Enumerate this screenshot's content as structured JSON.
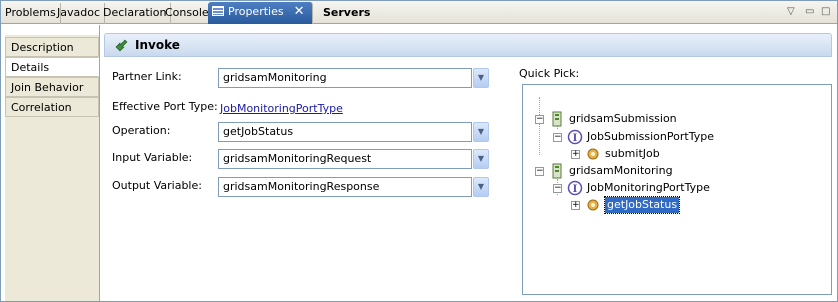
{
  "tabs": [
    {
      "label": "Problems"
    },
    {
      "label": "Javadoc"
    },
    {
      "label": "Declaration"
    },
    {
      "label": "Console"
    },
    {
      "label": "Properties",
      "close": "✕"
    },
    {
      "label": "Servers"
    }
  ],
  "view_menu": {
    "glyph": "▽",
    "minimize": "▭",
    "maximize": "□"
  },
  "sidebar": {
    "items": [
      {
        "label": "Description"
      },
      {
        "label": "Details"
      },
      {
        "label": "Join Behavior"
      },
      {
        "label": "Correlation"
      }
    ]
  },
  "section": {
    "title": "Invoke"
  },
  "form": {
    "partner_link": {
      "label": "Partner Link:",
      "value": "gridsamMonitoring"
    },
    "effective_port_type": {
      "label": "Effective Port Type:",
      "value": "JobMonitoringPortType"
    },
    "operation": {
      "label": "Operation:",
      "value": "getJobStatus"
    },
    "input_variable": {
      "label": "Input Variable:",
      "value": "gridsamMonitoringRequest"
    },
    "output_variable": {
      "label": "Output Variable:",
      "value": "gridsamMonitoringResponse"
    },
    "dropdown_glyph": "▼"
  },
  "quick_pick": {
    "label": "Quick Pick:",
    "expand_glyph": "+",
    "collapse_glyph": "−",
    "tree": [
      {
        "label": "gridsamSubmission",
        "icon": "partner-link-icon"
      },
      {
        "label": "JobSubmissionPortType",
        "icon": "interface-icon"
      },
      {
        "label": "submitJob",
        "icon": "operation-gear-icon"
      },
      {
        "label": "gridsamMonitoring",
        "icon": "partner-link-icon"
      },
      {
        "label": "JobMonitoringPortType",
        "icon": "interface-icon"
      },
      {
        "label": "getJobStatus",
        "icon": "operation-gear-icon"
      }
    ]
  },
  "colors": {
    "active_tab": "#3a6bb5",
    "selection": "#316ac5",
    "link": "#1a1aa6"
  }
}
